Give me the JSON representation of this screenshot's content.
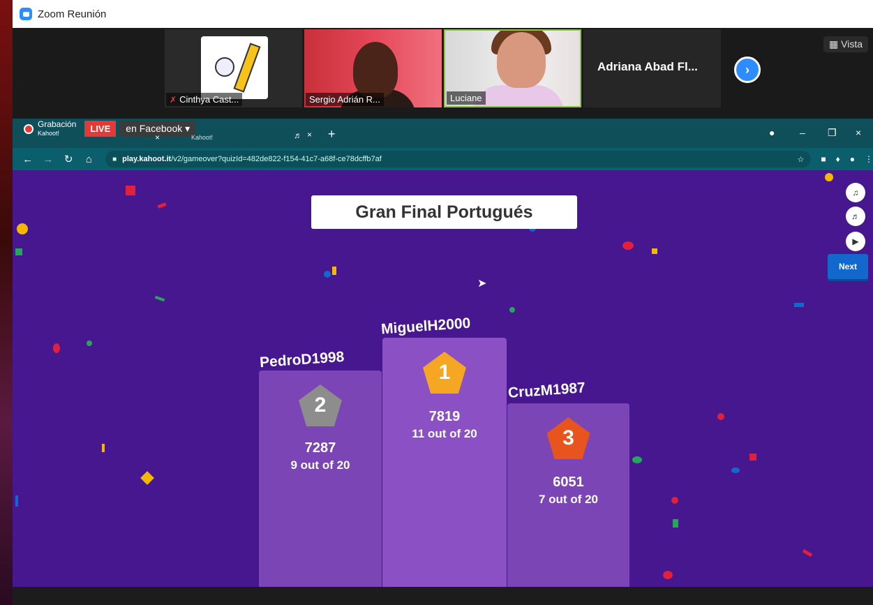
{
  "zoom": {
    "window_title": "Zoom Reunión",
    "participants": [
      {
        "name": "Cinthya Cast..."
      },
      {
        "name": "Sergio Adrián R..."
      },
      {
        "name": "Luciane"
      },
      {
        "name": "Adriana Abad Fl..."
      }
    ],
    "view_label": "Vista"
  },
  "browser": {
    "recording_label": "Grabación",
    "recording_sub": "Kahoot!",
    "live_label": "LIVE",
    "stream_target": "en Facebook",
    "tab2_label": "Kahoot!",
    "url_host": "play.kahoot.it",
    "url_path": "/v2/gameover?quizId=482de822-f154-41c7-a68f-ce78dcffb7af"
  },
  "kahoot": {
    "title": "Gran Final Portugués",
    "next_label": "Next",
    "podium": [
      {
        "rank": "1",
        "player": "MiguelH2000",
        "score": "7819",
        "correct": "11 out of 20"
      },
      {
        "rank": "2",
        "player": "PedroD1998",
        "score": "7287",
        "correct": "9 out of 20"
      },
      {
        "rank": "3",
        "player": "CruzM1987",
        "score": "6051",
        "correct": "7 out of 20"
      }
    ]
  },
  "colors": {
    "kahoot_bg": "#46178f",
    "gold": "#f5a623",
    "silver": "#8d8d8d",
    "bronze": "#e8541e",
    "zoom_blue": "#2d8cff"
  }
}
